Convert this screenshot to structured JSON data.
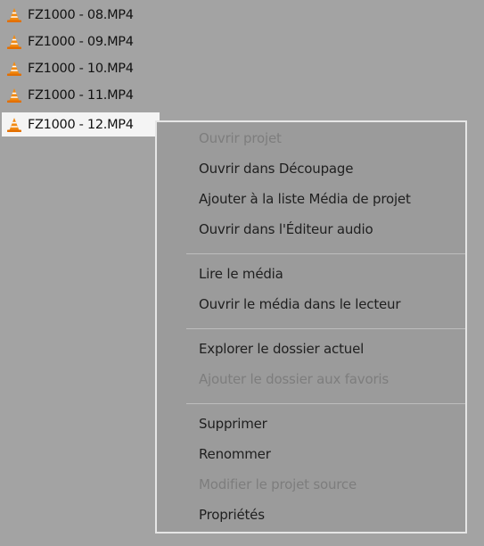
{
  "files": [
    {
      "name": "FZ1000 - 08.MP4",
      "icon": "vlc-cone-icon",
      "selected": false
    },
    {
      "name": "FZ1000 - 09.MP4",
      "icon": "vlc-cone-icon",
      "selected": false
    },
    {
      "name": "FZ1000 - 10.MP4",
      "icon": "vlc-cone-icon",
      "selected": false
    },
    {
      "name": "FZ1000 - 11.MP4",
      "icon": "vlc-cone-icon",
      "selected": false
    },
    {
      "name": "FZ1000 - 12.MP4",
      "icon": "vlc-cone-icon",
      "selected": true
    }
  ],
  "context_menu": {
    "items": [
      {
        "label": "Ouvrir projet",
        "enabled": false
      },
      {
        "label": "Ouvrir dans Découpage",
        "enabled": true
      },
      {
        "label": "Ajouter à la liste Média de projet",
        "enabled": true
      },
      {
        "label": "Ouvrir dans l'Éditeur audio",
        "enabled": true
      },
      {
        "label": "Lire le média",
        "enabled": true
      },
      {
        "label": "Ouvrir le média dans le lecteur",
        "enabled": true
      },
      {
        "label": "Explorer le dossier actuel",
        "enabled": true
      },
      {
        "label": "Ajouter le dossier aux favoris",
        "enabled": false
      },
      {
        "label": "Supprimer",
        "enabled": true
      },
      {
        "label": "Renommer",
        "enabled": true
      },
      {
        "label": "Modifier le projet source",
        "enabled": false
      },
      {
        "label": "Propriétés",
        "enabled": true
      }
    ]
  },
  "colors": {
    "background": "#a3a3a3",
    "menu_background": "#9b9b9b",
    "selected_row": "#f4f4f4",
    "icon_orange": "#f28a12",
    "text_enabled": "#1f1f1f",
    "text_disabled": "#7d7d7d"
  }
}
